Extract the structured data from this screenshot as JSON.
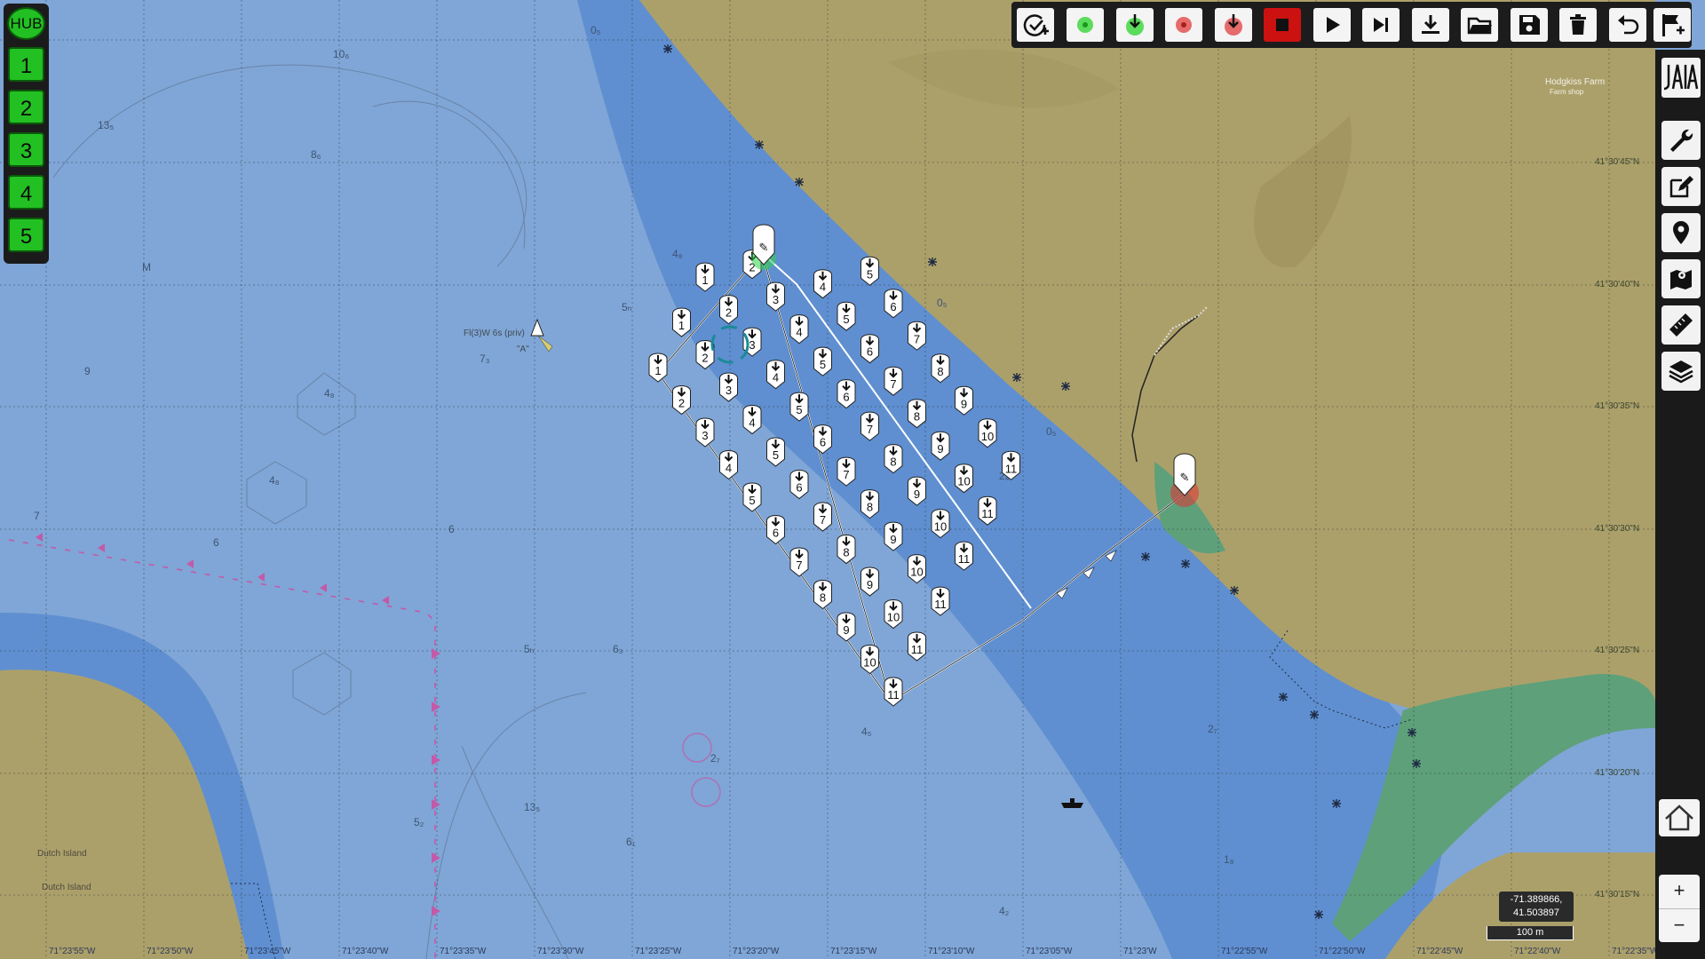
{
  "bots_panel": {
    "hub_label": "HUB",
    "bots": [
      "1",
      "2",
      "3",
      "4",
      "5"
    ]
  },
  "toolbar": {
    "buttons": [
      {
        "name": "mission-add-button",
        "icon": "check-circle-plus-icon",
        "color": "#f4f4f4"
      },
      {
        "name": "rally-green-button",
        "icon": "green-burst-icon",
        "color": "#36d636"
      },
      {
        "name": "rally-green-go-button",
        "icon": "green-download-icon",
        "color": "#36d636"
      },
      {
        "name": "rally-red-button",
        "icon": "red-burst-icon",
        "color": "#e24848"
      },
      {
        "name": "rally-red-go-button",
        "icon": "red-download-icon",
        "color": "#e24848"
      },
      {
        "name": "stop-all-button",
        "icon": "stop-icon",
        "color": "#cc1111"
      },
      {
        "name": "play-button",
        "icon": "play-icon",
        "color": "#f4f4f4"
      },
      {
        "name": "next-task-button",
        "icon": "skip-next-icon",
        "color": "#f4f4f4"
      },
      {
        "name": "download-button",
        "icon": "download-icon",
        "color": "#f4f4f4"
      },
      {
        "name": "open-folder-button",
        "icon": "folder-open-icon",
        "color": "#f4f4f4"
      },
      {
        "name": "save-button",
        "icon": "save-icon",
        "color": "#f4f4f4"
      },
      {
        "name": "delete-button",
        "icon": "trash-icon",
        "color": "#f4f4f4"
      },
      {
        "name": "undo-button",
        "icon": "undo-icon",
        "color": "#f4f4f4"
      },
      {
        "name": "flag-add-button",
        "icon": "flag-plus-icon",
        "color": "#f4f4f4"
      }
    ]
  },
  "side_menu": {
    "logo_text": "JAIA",
    "buttons": [
      "wrench-icon",
      "edit-icon",
      "location-pin-icon",
      "map-icon",
      "ruler-icon",
      "layers-icon"
    ]
  },
  "map": {
    "cursor_coord_line1": "-71.389866,",
    "cursor_coord_line2": "41.503897",
    "scale_label": "100 m",
    "zoom_in": "+",
    "zoom_out": "−",
    "lon_ticks": [
      "71°23'55\"W",
      "71°23'50\"W",
      "71°23'45\"W",
      "71°23'40\"W",
      "71°23'35\"W",
      "71°23'30\"W",
      "71°23'25\"W",
      "71°23'20\"W",
      "71°23'15\"W",
      "71°23'10\"W",
      "71°23'05\"W",
      "71°23'W",
      "71°22'55\"W",
      "71°22'50\"W",
      "71°22'45\"W",
      "71°22'40\"W",
      "71°22'35\"W"
    ],
    "lat_ticks": [
      "41°30'45\"N",
      "41°30'40\"N",
      "41°30'35\"N",
      "41°30'30\"N",
      "41°30'25\"N",
      "41°30'20\"N",
      "41°30'15\"N"
    ],
    "place_labels": [
      "Hodgkiss Farm",
      "Farm shop",
      "Dutch Island",
      "Dutch Island",
      "Fl(3)W 6s (priv)",
      "\"A\""
    ],
    "depth_soundings": [
      "10₆",
      "13₅",
      "8₆",
      "0₅",
      "9",
      "4₈",
      "7₃",
      "4₈",
      "5ₕ",
      "6",
      "7",
      "4₈",
      "2₄",
      "0₅",
      "6₃",
      "5ₕ",
      "2₇",
      "13₅",
      "5₂",
      "6₁",
      "4₂",
      "4₅",
      "1₈",
      "2₇",
      "M",
      "0₆"
    ],
    "mission": {
      "columns": [
        {
          "wps": [
            "1",
            "1",
            "1",
            "1",
            "1"
          ]
        },
        {
          "wps": [
            "2",
            "2",
            "2",
            "2",
            "2"
          ]
        }
      ],
      "wp_numbers": [
        "1",
        "2",
        "3",
        "4",
        "5",
        "6",
        "7",
        "8",
        "9",
        "10",
        "11"
      ]
    }
  }
}
